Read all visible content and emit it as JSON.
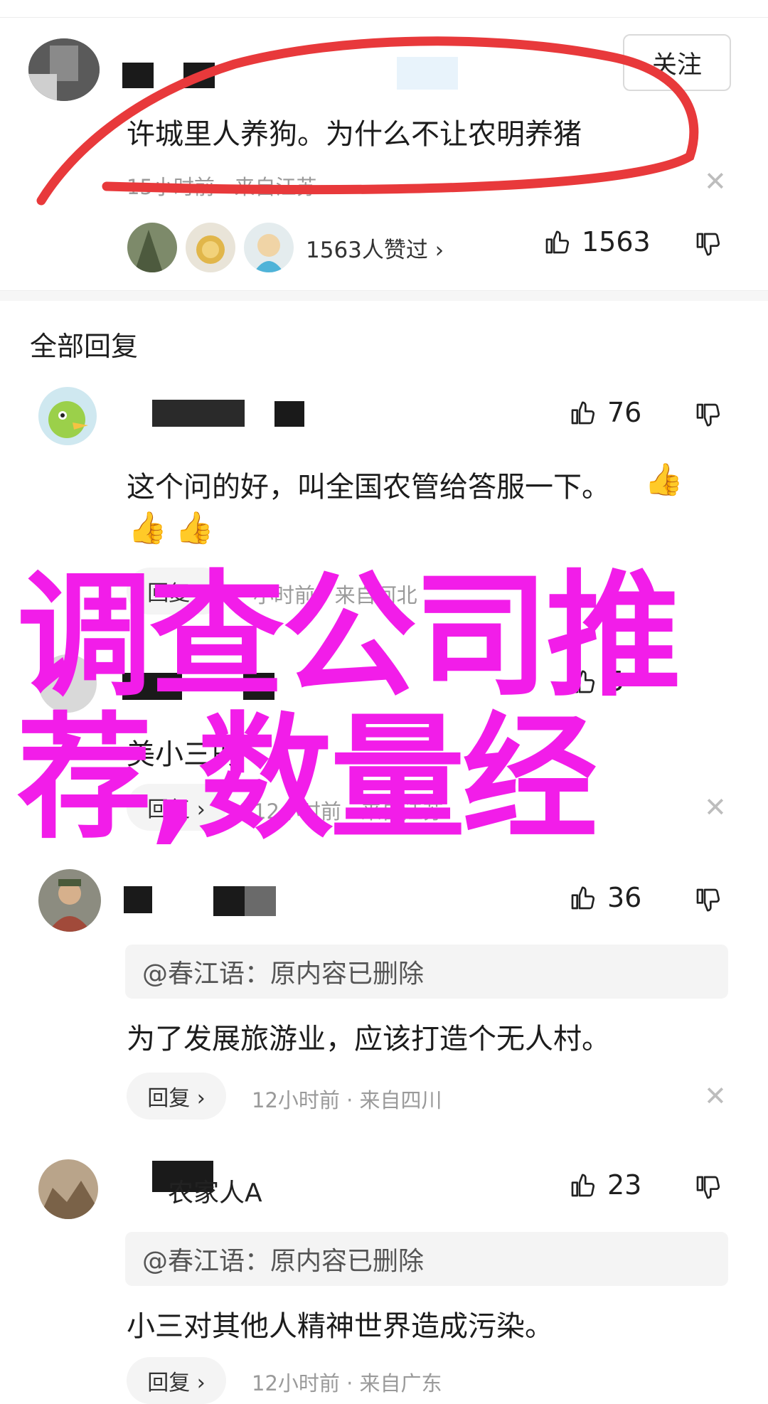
{
  "main_comment": {
    "follow_label": "关注",
    "text": "许城里人养狗。为什么不让农明养猪",
    "meta": "15小时前 · 来自江苏",
    "liked_summary": "1563人赞过 ›",
    "like_count": "1563"
  },
  "section_title": "全部回复",
  "replies": [
    {
      "text": "这个问的好，叫全国农管给答服一下。",
      "like_count": "76",
      "reply_label": "回复 ›",
      "meta": "小时前 · 来自河北"
    },
    {
      "text": "美小三的",
      "like_count": "5",
      "reply_label": "回复 ›",
      "meta": "12小时前 · 来自江苏"
    },
    {
      "quote": "@春江语：原内容已删除",
      "text": "为了发展旅游业，应该打造个无人村。",
      "like_count": "36",
      "reply_label": "回复 ›",
      "meta": "12小时前 · 来自四川"
    },
    {
      "username": "农家人A",
      "quote": "@春江语：原内容已删除",
      "text": "小三对其他人精神世界造成污染。",
      "like_count": "23",
      "reply_label": "回复 ›",
      "meta": "12小时前 · 来自广东"
    }
  ],
  "overlay": {
    "line1": "调查公司推",
    "line2": "荐,数量经",
    "color": "#f21de9"
  },
  "annotation_color": "#e8393b",
  "icons": [
    "thumbs-up-icon",
    "thumbs-down-icon",
    "close-icon",
    "thumbs-up-emoji"
  ]
}
